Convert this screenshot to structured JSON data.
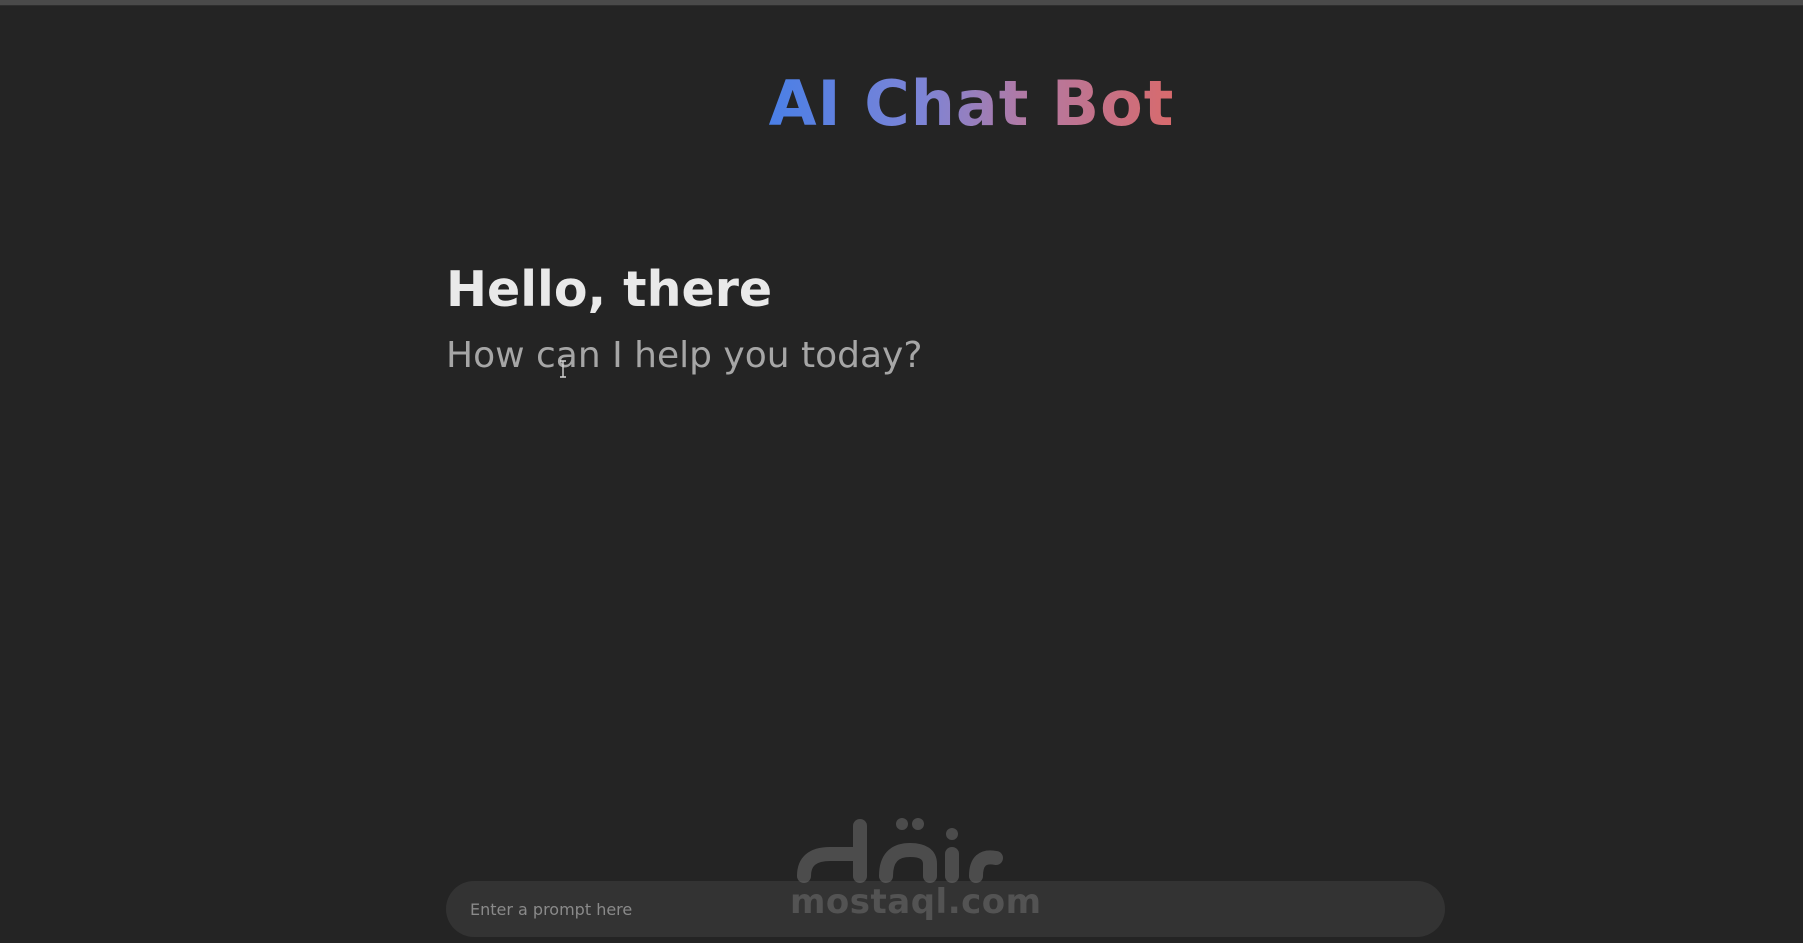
{
  "header": {
    "title": "AI Chat Bot"
  },
  "main": {
    "greeting": "Hello, there",
    "subtitle": "How can I help you today?"
  },
  "prompt": {
    "placeholder": "Enter a prompt here",
    "value": ""
  },
  "watermark": {
    "arabic": "مستقل",
    "text": "mostaql.com"
  },
  "colors": {
    "background": "#242424",
    "title_gradient": [
      "#4a7fe6",
      "#7d84d6",
      "#b07aa6",
      "#d86a6c"
    ],
    "greeting": "#e9e9e9",
    "subtitle": "#a6a6a6",
    "input_bg": "#333333"
  }
}
